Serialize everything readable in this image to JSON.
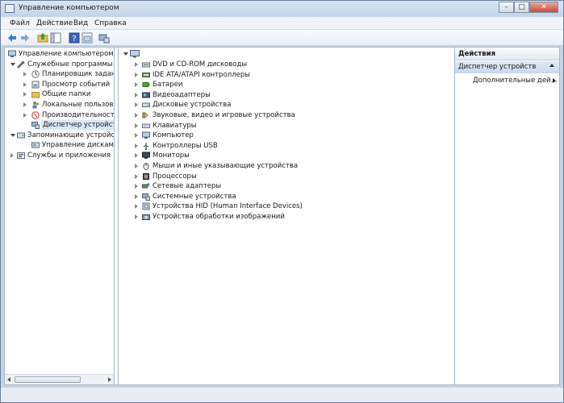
{
  "window": {
    "title": "Управление компьютером"
  },
  "caption_buttons": {
    "minimize": "–",
    "maximize": "□",
    "close": "✕"
  },
  "menu": {
    "file": "Файл",
    "action": "Действие",
    "view": "Вид",
    "help": "Справка"
  },
  "toolbar": {
    "buttons": [
      "back-arrow-icon",
      "forward-arrow-icon",
      "up-folder-icon",
      "show-hide-tree-icon",
      "help-icon",
      "properties-icon",
      "device-manager-icon"
    ]
  },
  "tree": {
    "root": "Управление компьютером (л",
    "items": [
      {
        "label": "Служебные программы",
        "level": 1,
        "expanded": true,
        "icon": "tools-icon"
      },
      {
        "label": "Планировщик заданий",
        "level": 2,
        "expanded": false,
        "icon": "clock-icon"
      },
      {
        "label": "Просмотр событий",
        "level": 2,
        "expanded": false,
        "icon": "event-viewer-icon"
      },
      {
        "label": "Общие папки",
        "level": 2,
        "expanded": false,
        "icon": "shared-folder-icon"
      },
      {
        "label": "Локальные пользовате",
        "level": 2,
        "expanded": false,
        "icon": "users-icon"
      },
      {
        "label": "Производительность",
        "level": 2,
        "expanded": false,
        "icon": "performance-icon"
      },
      {
        "label": "Диспетчер устройств",
        "level": 2,
        "expanded": null,
        "icon": "device-manager-icon",
        "selected": true
      },
      {
        "label": "Запоминающие устройст",
        "level": 1,
        "expanded": true,
        "icon": "storage-icon"
      },
      {
        "label": "Управление дисками",
        "level": 2,
        "expanded": null,
        "icon": "disk-management-icon"
      },
      {
        "label": "Службы и приложения",
        "level": 1,
        "expanded": false,
        "icon": "services-icon"
      }
    ]
  },
  "devices": {
    "root_icon": "computer-icon",
    "items": [
      {
        "label": "DVD и CD-ROM дисководы",
        "icon": "dvd-drive-icon"
      },
      {
        "label": "IDE ATA/ATAPI контроллеры",
        "icon": "ide-controller-icon"
      },
      {
        "label": "Батареи",
        "icon": "battery-icon"
      },
      {
        "label": "Видеоадаптеры",
        "icon": "display-adapter-icon"
      },
      {
        "label": "Дисковые устройства",
        "icon": "disk-drive-icon"
      },
      {
        "label": "Звуковые, видео и игровые устройства",
        "icon": "sound-icon"
      },
      {
        "label": "Клавиатуры",
        "icon": "keyboard-icon"
      },
      {
        "label": "Компьютер",
        "icon": "computer-icon"
      },
      {
        "label": "Контроллеры USB",
        "icon": "usb-icon"
      },
      {
        "label": "Мониторы",
        "icon": "monitor-icon"
      },
      {
        "label": "Мыши и иные указывающие устройства",
        "icon": "mouse-icon"
      },
      {
        "label": "Процессоры",
        "icon": "processor-icon"
      },
      {
        "label": "Сетевые адаптеры",
        "icon": "network-adapter-icon"
      },
      {
        "label": "Системные устройства",
        "icon": "system-devices-icon"
      },
      {
        "label": "Устройства HID (Human Interface Devices)",
        "icon": "hid-icon"
      },
      {
        "label": "Устройства обработки изображений",
        "icon": "imaging-icon"
      }
    ]
  },
  "actions": {
    "header": "Действия",
    "section": "Диспетчер устройств",
    "more": "Дополнительные дей..."
  },
  "colors": {
    "accent": "#c8d8ee",
    "selection": "#d9e6f5",
    "frame": "#c7d4e4"
  }
}
